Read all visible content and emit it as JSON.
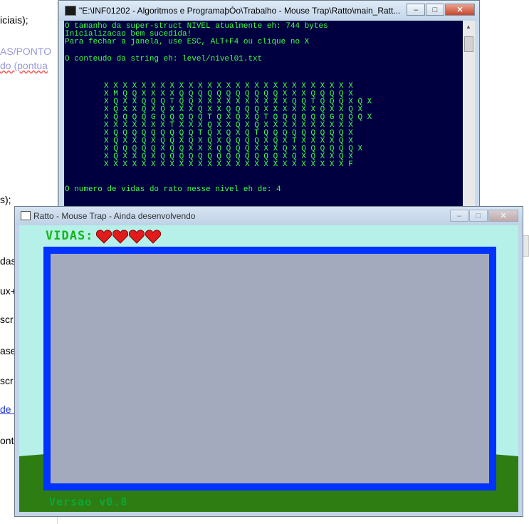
{
  "background_editor": {
    "fragments": [
      "iciais);",
      "AS/PONTO",
      "do (pontua",
      "s);",
      "das_",
      "ux+",
      "scr",
      "ase",
      "scr",
      "de v",
      "ont"
    ]
  },
  "console_window": {
    "title": "\"E:\\INF01202 - Algoritmos e ProgramaþÒo\\Trabalho - Mouse Trap\\Ratto\\main_Ratt...",
    "buttons": {
      "minimize": "–",
      "maximize": "□",
      "close": "✕"
    },
    "lines": [
      "O tamanho da super-struct NIVEL atualmente eh: 744 bytes",
      "Inicializacao bem sucedida!",
      "Para fechar a janela, use ESC, ALT+F4 ou clique no X",
      "",
      "O conteudo da string eh: level/nivel01.txt"
    ],
    "grid": [
      "X X X X X X X X X X X X X X X X X X X X X X X X X X X",
      "X M Q Q X X X X Q Q Q Q Q Q Q Q Q Q Q X X X Q Q Q Q X",
      "X Q X X Q Q Q T Q Q X X X X X X X X X X Q Q T Q Q Q X Q X",
      "X Q X X Q X Q X X X Q X X Q Q Q Q X X X X X X Q X X Q X",
      "X Q Q Q Q G Q Q Q Q Q T Q X Q X Q T Q Q Q Q Q Q G Q Q Q X",
      "X X X X X X X T X X X Q X X Q X Q X X X X X X X X X X",
      "X Q Q Q Q Q Q Q Q Q T Q X Q X Q T Q Q Q Q Q Q Q Q Q X",
      "X Q X X Q X Q Q X Q X Q X Q Q Q Q X Q X T X X X X Q X",
      "X Q Q Q Q Q X Q Q X X X Q Q Q Q X X X Q X Q Q Q Q Q Q X",
      "X Q X X Q X Q Q Q Q Q Q Q Q Q Q Q Q Q X Q X Q X X Q X",
      "X X X X X X X X X X X X X X X X X X X X X X X X X X F"
    ],
    "footer_line": "O numero de vidas do rato nesse nivel eh de: 4"
  },
  "game_window": {
    "title": "Ratto - Mouse Trap - Ainda desenvolvendo",
    "buttons": {
      "minimize": "–",
      "maximize": "□",
      "close": "✕"
    },
    "lives_label": "VIDAS:",
    "lives": 4,
    "version": "Versao v0.8",
    "colors": {
      "sky": "#b5f1e8",
      "board_border": "#0033ff",
      "board_fill": "#a4aabe",
      "grass": "#2e7d12",
      "heart": "#e01c1c",
      "label_green": "#17b517"
    }
  }
}
